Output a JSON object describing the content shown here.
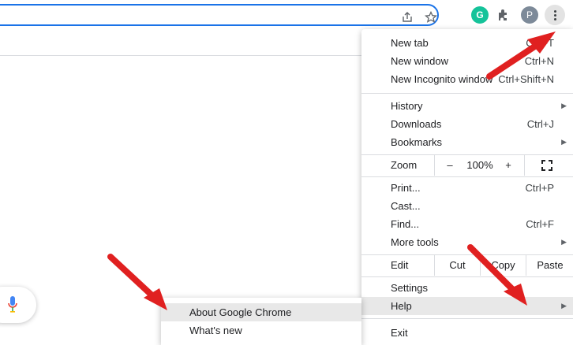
{
  "toolbar": {
    "icons": [
      "share-icon",
      "star-icon",
      "grammarly-icon",
      "extensions-icon",
      "profile-avatar",
      "kebab-menu-icon"
    ],
    "grammarly_letter": "G",
    "avatar_letter": "P"
  },
  "menu": {
    "new_tab": {
      "label": "New tab",
      "shortcut": "Ctrl+T"
    },
    "new_window": {
      "label": "New window",
      "shortcut": "Ctrl+N"
    },
    "new_incognito": {
      "label": "New Incognito window",
      "shortcut": "Ctrl+Shift+N"
    },
    "history": {
      "label": "History"
    },
    "downloads": {
      "label": "Downloads",
      "shortcut": "Ctrl+J"
    },
    "bookmarks": {
      "label": "Bookmarks"
    },
    "zoom": {
      "label": "Zoom",
      "minus": "–",
      "level": "100%",
      "plus": "+"
    },
    "print": {
      "label": "Print...",
      "shortcut": "Ctrl+P"
    },
    "cast": {
      "label": "Cast..."
    },
    "find": {
      "label": "Find...",
      "shortcut": "Ctrl+F"
    },
    "more_tools": {
      "label": "More tools"
    },
    "edit": {
      "label": "Edit",
      "cut": "Cut",
      "copy": "Copy",
      "paste": "Paste"
    },
    "settings": {
      "label": "Settings"
    },
    "help": {
      "label": "Help"
    },
    "exit": {
      "label": "Exit"
    }
  },
  "help_submenu": {
    "about": "About Google Chrome",
    "whats_new": "What's new"
  },
  "colors": {
    "accent": "#1a73e8",
    "annotation_arrow": "#e02020",
    "highlight": "#e8e8e8"
  }
}
